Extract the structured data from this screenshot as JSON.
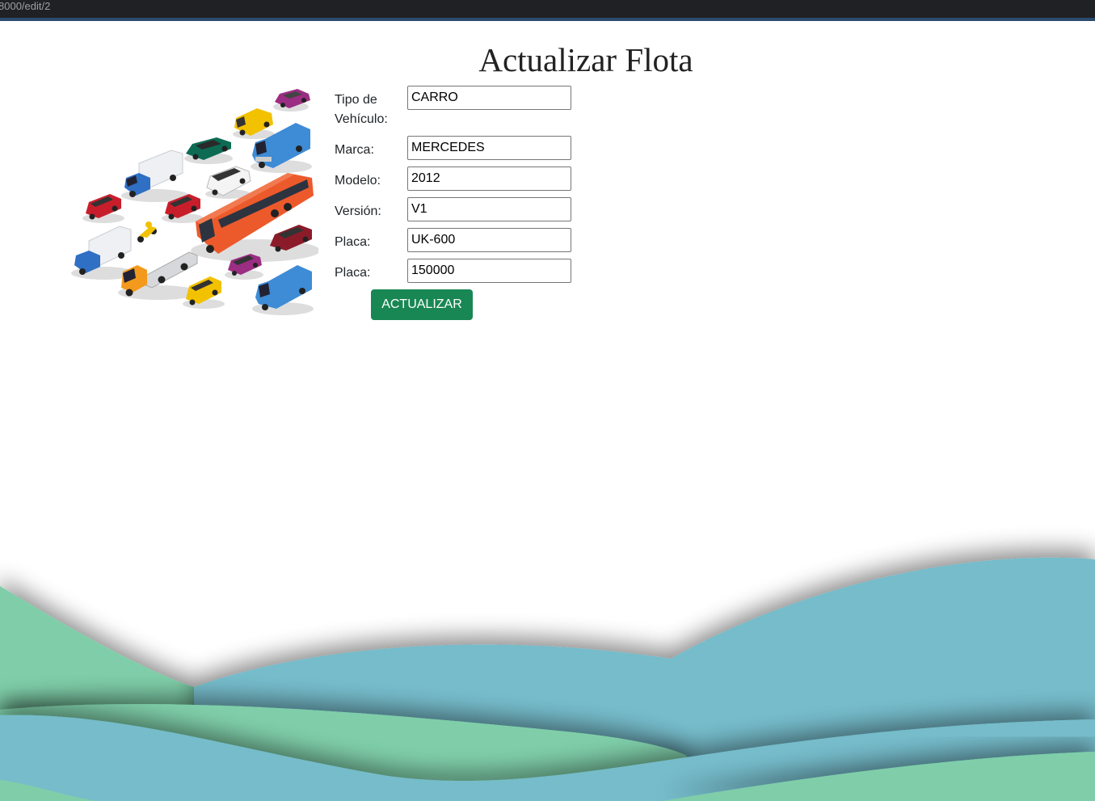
{
  "browser": {
    "url": "8000/edit/2"
  },
  "page": {
    "title": "Actualizar Flota"
  },
  "form": {
    "fields": [
      {
        "label": "Tipo de Vehículo:",
        "value": "CARRO"
      },
      {
        "label": "Marca:",
        "value": "MERCEDES"
      },
      {
        "label": "Modelo:",
        "value": "2012"
      },
      {
        "label": "Versión:",
        "value": "V1"
      },
      {
        "label": "Placa:",
        "value": "UK-600"
      },
      {
        "label": "Placa:",
        "value": "150000"
      }
    ],
    "submit_label": "ACTUALIZAR"
  },
  "colors": {
    "button": "#198754",
    "wave_teal": "#76bccb",
    "wave_green": "#7fcea9"
  },
  "image": {
    "icon": "vehicle-fleet-illustration"
  }
}
